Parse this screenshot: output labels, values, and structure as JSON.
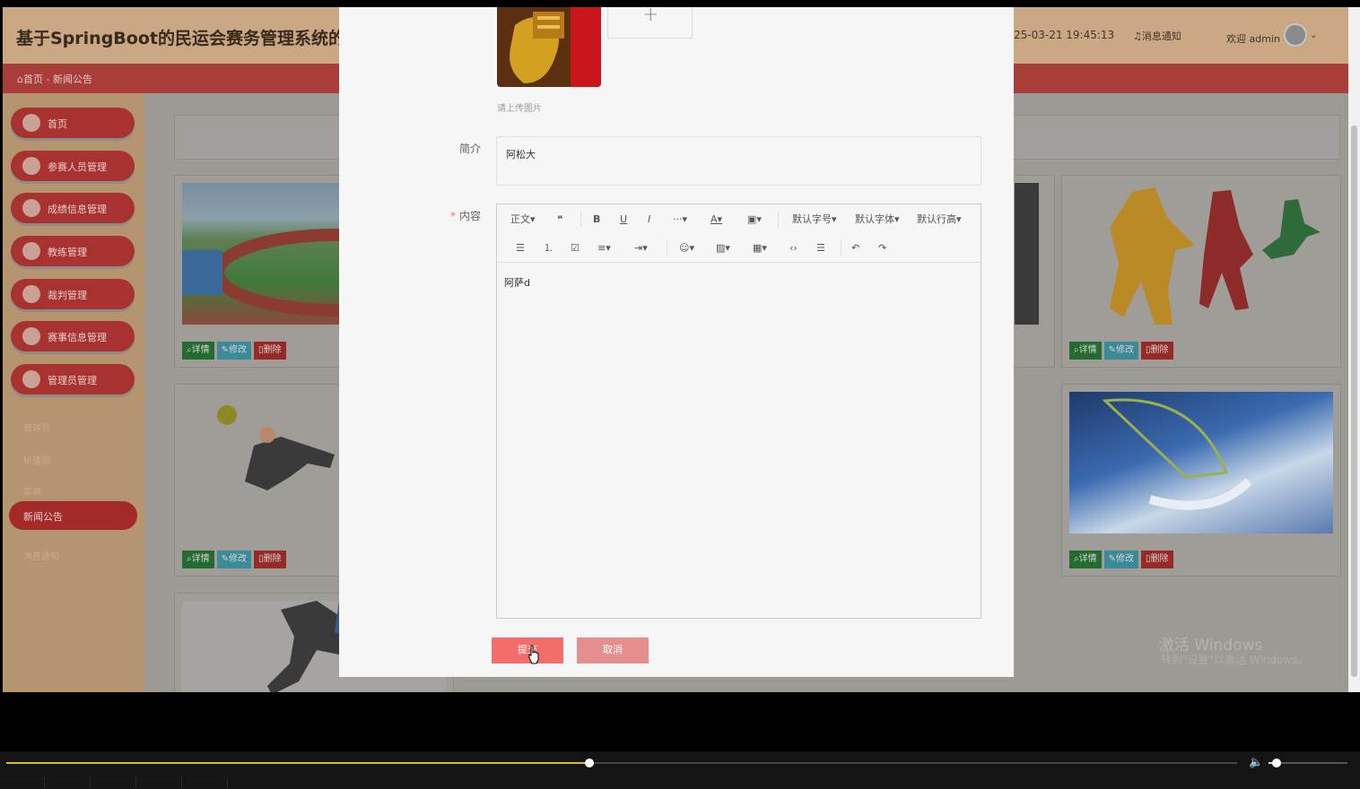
{
  "app": {
    "title": "基于SpringBoot的民运会赛务管理系统的设",
    "datetime": "25-03-21 19:45:13",
    "notify": "消息通知",
    "welcome": "欢迎 admin",
    "breadcrumb_home": "首页",
    "breadcrumb_sep": "-",
    "breadcrumb_current": "新闻公告"
  },
  "sidebar": {
    "items": [
      {
        "label": "首页"
      },
      {
        "label": "参赛人员管理"
      },
      {
        "label": "成绩信息管理"
      },
      {
        "label": "教练管理"
      },
      {
        "label": "裁判管理"
      },
      {
        "label": "赛事信息管理"
      },
      {
        "label": "管理员管理"
      }
    ],
    "sub_items": [
      "管理员",
      "轮播图",
      "菜单"
    ],
    "active": "新闻公告",
    "after_active": "消息通知"
  },
  "cards": {
    "detail": "详情",
    "edit": "修改",
    "delete": "删除"
  },
  "dialog": {
    "upload_tip": "请上传图片",
    "intro_label": "简介",
    "intro_value": "阿松大",
    "content_label": "内容",
    "required_mark": "*",
    "toolbar": {
      "paragraph": "正文",
      "font_size": "默认字号",
      "font_family": "默认字体",
      "line_height": "默认行高"
    },
    "content_value": "阿萨d",
    "submit": "提交",
    "cancel": "取消"
  },
  "watermark": {
    "line1": "激活 Windows",
    "line2": "转到\"设置\"以激活 Windows。"
  },
  "player": {
    "progress": 0.474,
    "volume": 0.1
  },
  "colors": {
    "accent": "#f36d6a",
    "cancel": "#e48f8d",
    "progress": "#d8c01a"
  }
}
